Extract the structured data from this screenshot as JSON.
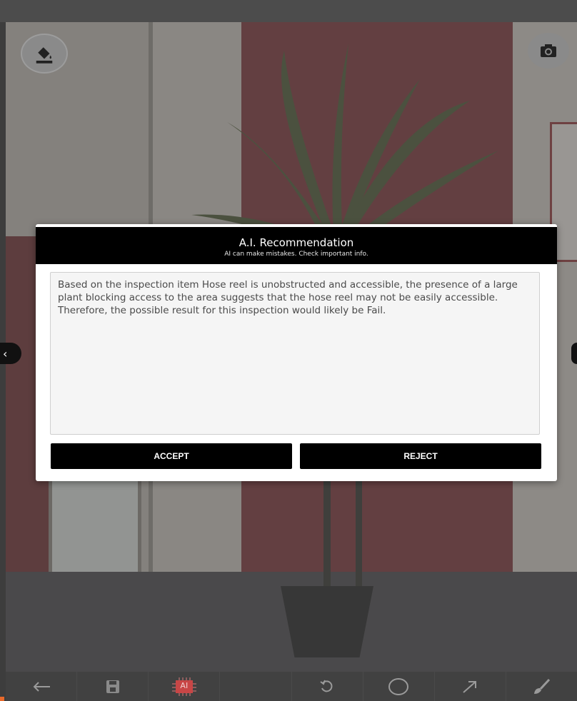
{
  "dialog": {
    "title": "A.I. Recommendation",
    "subtitle": "AI can make mistakes. Check important info.",
    "recommendation_text": "Based on the inspection item Hose reel is unobstructed and accessible, the presence of a large plant blocking access to the area suggests that the hose reel may not be easily accessible. Therefore, the possible result for this inspection would likely be Fail.",
    "accept_label": "ACCEPT",
    "reject_label": "REJECT"
  },
  "toolbar": {
    "ai_label": "AI",
    "items": [
      "back-arrow-icon",
      "save-icon",
      "ai-chip-icon",
      "blank",
      "undo-icon",
      "circle-icon",
      "arrow-icon",
      "brush-icon"
    ]
  },
  "colors": {
    "dialog_header": "#000000",
    "toolbar_bg": "#414141",
    "ai_chip": "#c84646"
  }
}
